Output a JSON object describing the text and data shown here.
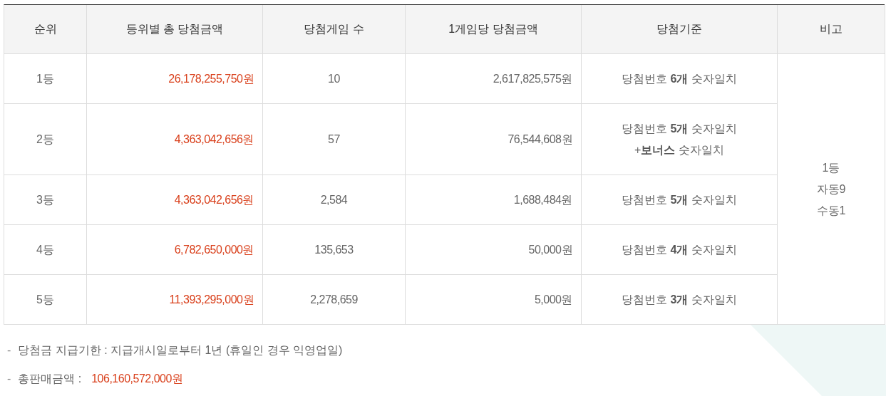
{
  "table": {
    "columns": [
      "순위",
      "등위별 총 당첨금액",
      "당첨게임 수",
      "1게임당 당첨금액",
      "당첨기준",
      "비고"
    ],
    "rows": [
      {
        "rank": "1등",
        "total": "26,178,255,750원",
        "games": "10",
        "per_game": "2,617,825,575원",
        "criteria": [
          "당첨번호 **6개** 숫자일치"
        ]
      },
      {
        "rank": "2등",
        "total": "4,363,042,656원",
        "games": "57",
        "per_game": "76,544,608원",
        "criteria": [
          "당첨번호 **5개** 숫자일치",
          "+**보너스** 숫자일치"
        ]
      },
      {
        "rank": "3등",
        "total": "4,363,042,656원",
        "games": "2,584",
        "per_game": "1,688,484원",
        "criteria": [
          "당첨번호 **5개** 숫자일치"
        ]
      },
      {
        "rank": "4등",
        "total": "6,782,650,000원",
        "games": "135,653",
        "per_game": "50,000원",
        "criteria": [
          "당첨번호 **4개** 숫자일치"
        ]
      },
      {
        "rank": "5등",
        "total": "11,393,295,000원",
        "games": "2,278,659",
        "per_game": "5,000원",
        "criteria": [
          "당첨번호 **3개** 숫자일치"
        ]
      }
    ],
    "remark": [
      "1등",
      "자동9",
      "수동1"
    ]
  },
  "notes": [
    {
      "bullet": "-",
      "label": "당첨금 지급기한 : 지급개시일로부터 1년 (휴일인 경우 익영업일)"
    },
    {
      "bullet": "-",
      "label": "총판매금액 :",
      "value": "106,160,572,000원"
    }
  ]
}
